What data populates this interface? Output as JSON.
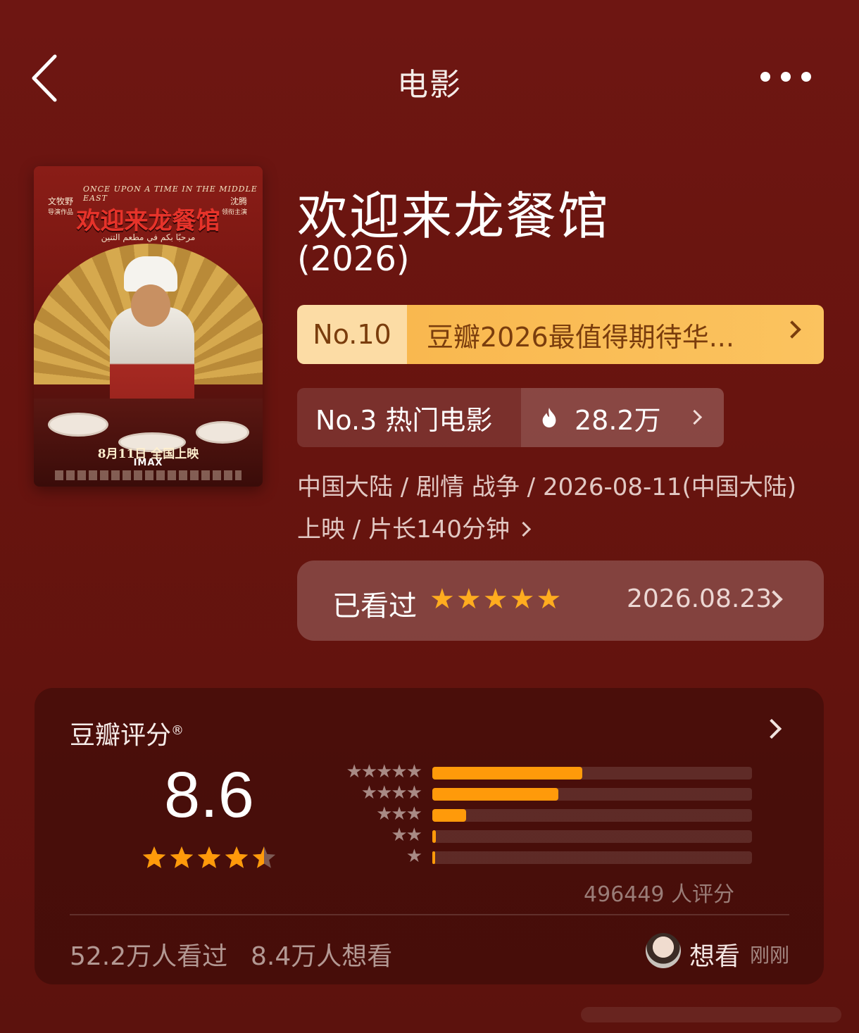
{
  "header": {
    "title": "电影"
  },
  "poster": {
    "english_title": "ONCE UPON A TIME IN THE MIDDLE EAST",
    "chinese_title": "欢迎来龙餐馆",
    "arabic_title": "مرحبًا بكم في مطعم التنين",
    "director": "文牧野",
    "director_role": "导演作品",
    "lead": "沈腾",
    "lead_role": "领衔主演",
    "release": "8月11日 全国上映",
    "format": "IMAX"
  },
  "movie": {
    "title": "欢迎来龙餐馆",
    "year": "(2026)"
  },
  "ranking": {
    "number": "No.10",
    "list_name": "豆瓣2026最值得期待华..."
  },
  "hot": {
    "rank": "No.3 热门电影",
    "count": "28.2万"
  },
  "meta": {
    "line1": "中国大陆 / 剧情 战争 / 2026-08-11(中国大陆)",
    "line2": "上映 / 片长140分钟"
  },
  "watched": {
    "label": "已看过",
    "stars": "★★★★★",
    "user_rating": 5,
    "date": "2026.08.23"
  },
  "rating": {
    "title": "豆瓣评分",
    "registered": "®",
    "score": "8.6",
    "star_value": 4.5,
    "count": "496449 人评分",
    "distribution": [
      {
        "stars": "★★★★★",
        "fraction": 0.47
      },
      {
        "stars": "★★★★",
        "fraction": 0.395
      },
      {
        "stars": "★★★",
        "fraction": 0.105
      },
      {
        "stars": "★★",
        "fraction": 0.012
      },
      {
        "stars": "★",
        "fraction": 0.008
      }
    ],
    "watched_count": "52.2万人看过",
    "want_count": "8.4万人想看",
    "action_label": "想看",
    "action_time": "刚刚"
  },
  "colors": {
    "background": "#6e1612",
    "accent": "#ff9a0a",
    "rank_badge": "#f9b84f"
  }
}
